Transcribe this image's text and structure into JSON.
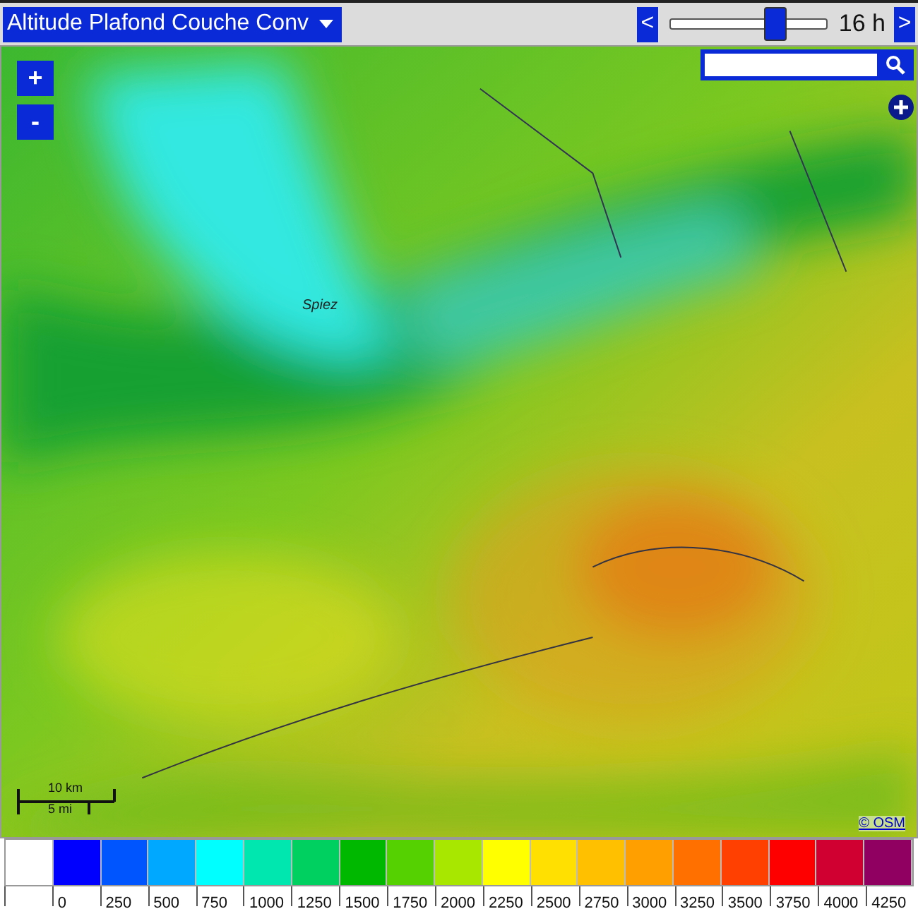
{
  "layer_menu": {
    "label": "Altitude Plafond Couche Conv"
  },
  "time": {
    "prev": "<",
    "next": ">",
    "level": 0.67,
    "reading": "16 h"
  },
  "map": {
    "zoom_in": "+",
    "zoom_out": "-",
    "place_label": "Spiez",
    "scale": {
      "metric": "10 km",
      "imperial": "5 mi"
    },
    "attribution": "© OSM"
  },
  "legend": [
    {
      "color": "#ffffff"
    },
    {
      "color": "#0000ff",
      "label": "0"
    },
    {
      "color": "#0055ff",
      "label": "250"
    },
    {
      "color": "#00a8ff",
      "label": "500"
    },
    {
      "color": "#00ffff",
      "label": "750"
    },
    {
      "color": "#00e8b0",
      "label": "1000"
    },
    {
      "color": "#00d060",
      "label": "1250"
    },
    {
      "color": "#00b800",
      "label": "1500"
    },
    {
      "color": "#55d000",
      "label": "1750"
    },
    {
      "color": "#a8e800",
      "label": "2000"
    },
    {
      "color": "#ffff00",
      "label": "2250"
    },
    {
      "color": "#ffe000",
      "label": "2500"
    },
    {
      "color": "#ffc000",
      "label": "2750"
    },
    {
      "color": "#ffa000",
      "label": "3000"
    },
    {
      "color": "#ff7000",
      "label": "3250"
    },
    {
      "color": "#ff4000",
      "label": "3500"
    },
    {
      "color": "#ff0000",
      "label": "3750"
    },
    {
      "color": "#d00030",
      "label": "4000"
    },
    {
      "color": "#900060",
      "label": "4250"
    }
  ]
}
